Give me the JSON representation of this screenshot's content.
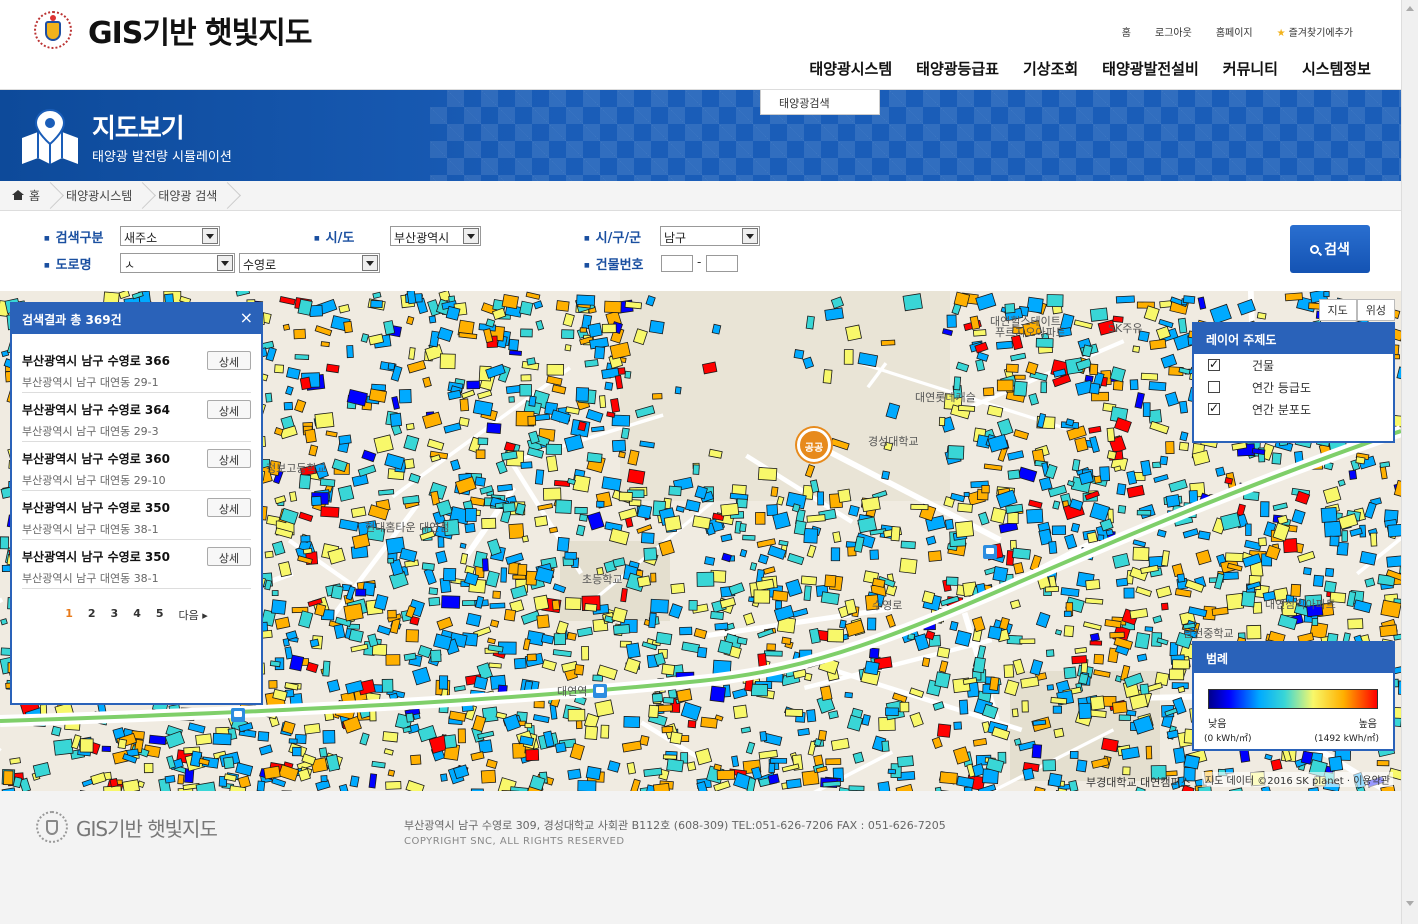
{
  "site": {
    "title": "GIS기반 햇빛지도"
  },
  "util_links": [
    "홈",
    "로그아웃",
    "홈페이지",
    "즐겨찾기에추가"
  ],
  "gnb": [
    "태양광시스템",
    "태양광등급표",
    "기상조회",
    "태양광발전설비",
    "커뮤니티",
    "시스템정보"
  ],
  "submenu": {
    "item": "태양광검색"
  },
  "banner": {
    "title": "지도보기",
    "subtitle": "태양광 발전량 시뮬레이션"
  },
  "breadcrumb": [
    "홈",
    "태양광시스템",
    "태양광 검색"
  ],
  "search": {
    "type_label": "검색구분",
    "type_value": "새주소",
    "sido_label": "시/도",
    "sido_value": "부산광역시",
    "sigungu_label": "시/구/군",
    "sigungu_value": "남구",
    "road_label": "도로명",
    "road_initial": "ㅅ",
    "road_value": "수영로",
    "building_label": "건물번호",
    "dash": "-",
    "button": "검색"
  },
  "map": {
    "type_map": "지도",
    "type_sat": "위성",
    "marker": "공공",
    "credit_left": "부경대학교 대연캠퍼스",
    "credit_right": "지도 데이터 ©2016 SK planet · 이용약관",
    "labels": [
      "대연힐스테이트",
      "푸르지오아파트",
      "대연롯데캐슬",
      "경성대학교",
      "현대홈타운 대연점",
      "초등학교",
      "남천중학교",
      "대연삼익아파트",
      "수영로",
      "대연역",
      "경성대학교 대연캠퍼스",
      "정보고등학교",
      "SK주유"
    ]
  },
  "results": {
    "header": "검색결과 총 369건",
    "close": "×",
    "items": [
      {
        "title": "부산광역시 남구 수영로 366",
        "sub": "부산광역시 남구 대연동 29-1",
        "btn": "상세"
      },
      {
        "title": "부산광역시 남구 수영로 364",
        "sub": "부산광역시 남구 대연동 29-3",
        "btn": "상세"
      },
      {
        "title": "부산광역시 남구 수영로 360",
        "sub": "부산광역시 남구 대연동 29-10",
        "btn": "상세"
      },
      {
        "title": "부산광역시 남구 수영로 350",
        "sub": "부산광역시 남구 대연동 38-1",
        "btn": "상세"
      },
      {
        "title": "부산광역시 남구 수영로 350",
        "sub": "부산광역시 남구 대연동 38-1",
        "btn": "상세"
      }
    ],
    "pages": [
      "1",
      "2",
      "3",
      "4",
      "5"
    ],
    "next": "다음 ▸"
  },
  "layers": {
    "header": "레이어 주제도",
    "items": [
      {
        "label": "건물",
        "checked": true
      },
      {
        "label": "연간 등급도",
        "checked": false
      },
      {
        "label": "연간 분포도",
        "checked": true
      }
    ]
  },
  "legend": {
    "header": "범례",
    "low": "낮음",
    "high": "높음",
    "low_unit": "(0 kWh/㎡)",
    "high_unit": "(1492 kWh/㎡)",
    "colors": [
      "#00008b",
      "#0000ff",
      "#00aaff",
      "#39d6d6",
      "#f8f86a",
      "#ffb000",
      "#ff0000"
    ]
  },
  "footer": {
    "title": "GIS기반 햇빛지도",
    "address": "부산광역시 남구 수영로 309, 경성대학교 사회관 B112호 (608-309) TEL:051-626-7206 FAX : 051-626-7205",
    "copyright": "COPYRIGHT SNC, ALL RIGHTS RESERVED"
  }
}
